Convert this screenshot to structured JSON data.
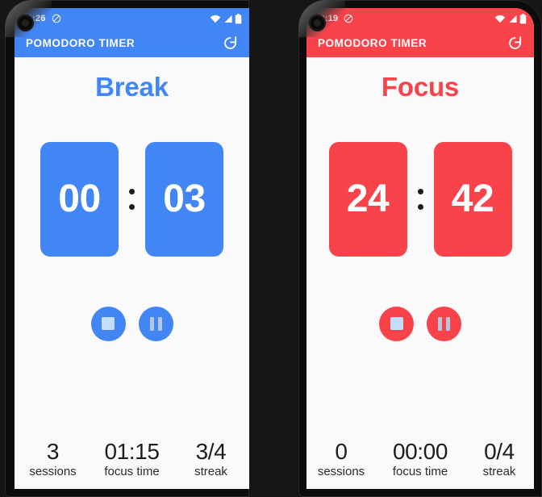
{
  "phones": [
    {
      "id": "left-phone",
      "accent": "#4285f4",
      "appbar_bg": "#4285f4",
      "statusbar_bg": "#4285f4",
      "status": {
        "clock": "11:26",
        "silent_icon": "do-not-disturb-icon",
        "wifi_icon": "wifi-icon",
        "signal_icon": "cellular-signal-icon",
        "battery_icon": "battery-icon"
      },
      "appbar": {
        "title": "POMODORO TIMER",
        "reset_icon": "refresh-icon"
      },
      "mode_title": "Break",
      "timer": {
        "minutes": "00",
        "seconds": "03",
        "separator": ":"
      },
      "controls": [
        {
          "name": "stop-button",
          "icon": "stop-icon"
        },
        {
          "name": "pause-button",
          "icon": "pause-icon"
        }
      ],
      "stats": [
        {
          "value": "3",
          "label": "sessions"
        },
        {
          "value": "01:15",
          "label": "focus time"
        },
        {
          "value": "3/4",
          "label": "streak"
        }
      ]
    },
    {
      "id": "right-phone",
      "accent": "#f9434b",
      "appbar_bg": "#f9434b",
      "statusbar_bg": "#f9434b",
      "status": {
        "clock": "12:19",
        "silent_icon": "do-not-disturb-icon",
        "wifi_icon": "wifi-icon",
        "signal_icon": "cellular-signal-icon",
        "battery_icon": "battery-icon"
      },
      "appbar": {
        "title": "POMODORO TIMER",
        "reset_icon": "refresh-icon"
      },
      "mode_title": "Focus",
      "timer": {
        "minutes": "24",
        "seconds": "42",
        "separator": ":"
      },
      "controls": [
        {
          "name": "stop-button",
          "icon": "stop-icon"
        },
        {
          "name": "pause-button",
          "icon": "pause-icon"
        }
      ],
      "stats": [
        {
          "value": "0",
          "label": "sessions"
        },
        {
          "value": "00:00",
          "label": "focus time"
        },
        {
          "value": "0/4",
          "label": "streak"
        }
      ]
    }
  ]
}
